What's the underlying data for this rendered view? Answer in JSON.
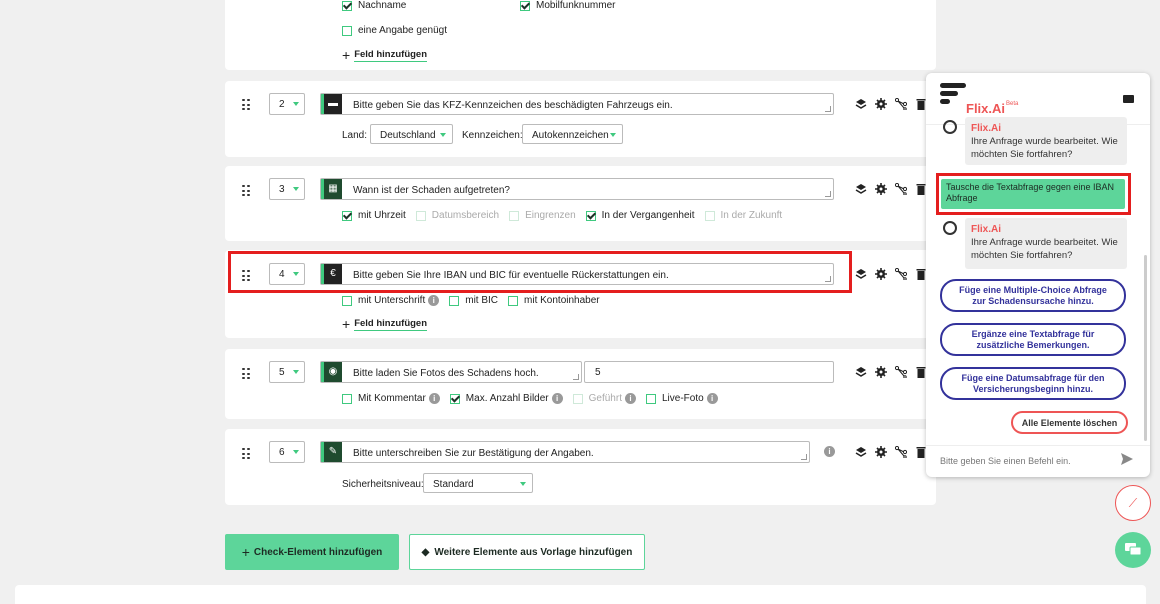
{
  "card1": {
    "opt_nachname": "Nachname",
    "opt_mobil": "Mobilfunknummer",
    "opt_eine_angabe": "eine Angabe genügt",
    "add_field": "Feld hinzufügen"
  },
  "card2": {
    "number": "2",
    "question": "Bitte geben Sie das KFZ-Kennzeichen des beschädigten Fahrzeugs ein.",
    "land_label": "Land:",
    "land_value": "Deutschland",
    "kennzeichen_label": "Kennzeichen:",
    "kennzeichen_value": "Autokennzeichen"
  },
  "card3": {
    "number": "3",
    "question": "Wann ist der Schaden aufgetreten?",
    "options": [
      "mit Uhrzeit",
      "Datumsbereich",
      "Eingrenzen",
      "In der Vergangenheit",
      "In der Zukunft"
    ]
  },
  "card4": {
    "number": "4",
    "question": "Bitte geben Sie Ihre IBAN und BIC für eventuelle Rückerstattungen ein.",
    "options": [
      "mit Unterschrift",
      "mit BIC",
      "mit Kontoinhaber"
    ],
    "add_field": "Feld hinzufügen"
  },
  "card5": {
    "number": "5",
    "question": "Bitte laden Sie Fotos des Schadens hoch.",
    "max_value": "5",
    "options": [
      "Mit Kommentar",
      "Max. Anzahl Bilder",
      "Geführt",
      "Live-Foto"
    ]
  },
  "card6": {
    "number": "6",
    "question": "Bitte unterschreiben Sie zur Bestätigung der Angaben.",
    "security_label": "Sicherheitsniveau:",
    "security_value": "Standard"
  },
  "buttons": {
    "add_check": "Check-Element hinzufügen",
    "add_template": "Weitere Elemente aus Vorlage hinzufügen"
  },
  "chat": {
    "brand": "Flix.Ai",
    "beta": "Beta",
    "bot_name": "Flix.Ai",
    "bot_msg": "Ihre Anfrage wurde bearbeitet. Wie möchten Sie fortfahren?",
    "user_msg": "Tausche die Textabfrage gegen eine IBAN Abfrage",
    "suggestions": [
      "Füge eine Multiple-Choice Abfrage zur Schadensursache hinzu.",
      "Ergänze eine Textabfrage für zusätzliche Bemerkungen.",
      "Füge eine Datumsabfrage für den Versicherungsbeginn hinzu."
    ],
    "delete_all": "Alle Elemente löschen",
    "input_placeholder": "Bitte geben Sie einen Befehl ein."
  },
  "colors": {
    "accent": "#5dd59a",
    "brand_red": "#e55555",
    "highlight": "#e41e1e",
    "suggestion": "#33329b"
  }
}
